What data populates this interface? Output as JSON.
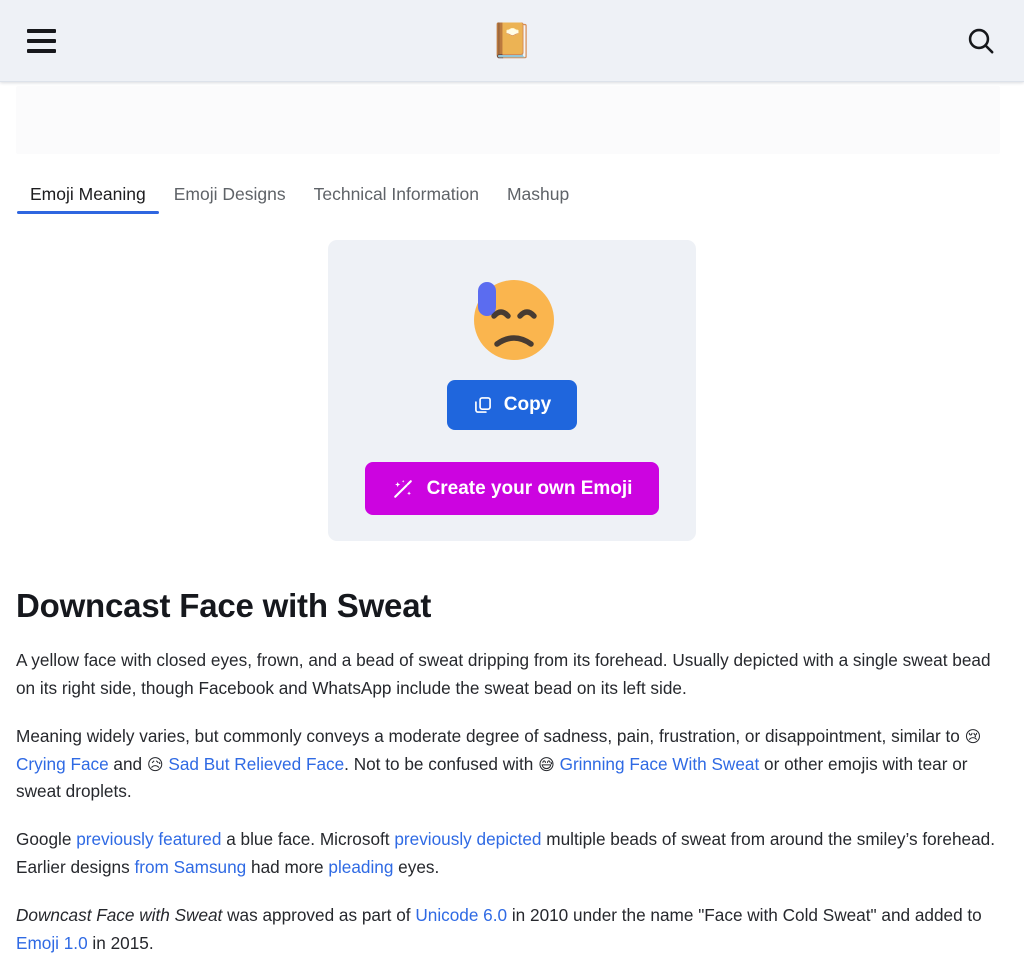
{
  "header": {
    "menu_icon": "hamburger-menu-icon",
    "logo_icon": "notebook-with-decorative-cover-emoji",
    "logo_glyph": "📔",
    "search_icon": "search-icon"
  },
  "ad_slot": {
    "label": ""
  },
  "tabs": [
    {
      "label": "Emoji Meaning",
      "active": true
    },
    {
      "label": "Emoji Designs",
      "active": false
    },
    {
      "label": "Technical Information",
      "active": false
    },
    {
      "label": "Mashup",
      "active": false
    }
  ],
  "emoji_card": {
    "emoji_name": "downcast-face-with-sweat",
    "emoji_glyph": "😓",
    "colors": {
      "face": "#fab54e",
      "features": "#473b32",
      "sweat": "#5b6cf0",
      "card_bg": "#eef1f6"
    },
    "copy_button": {
      "label": "Copy",
      "icon": "copy-icon",
      "color": "#1f66dd"
    },
    "create_button": {
      "label": "Create your own Emoji",
      "icon": "magic-wand-icon",
      "color": "#cc04e0"
    }
  },
  "article": {
    "title": "Downcast Face with Sweat",
    "paragraphs": {
      "p1": {
        "t1": "A yellow face with closed eyes, frown, and a bead of sweat dripping from its forehead. Usually depicted with a single sweat bead on its right side, though Facebook and WhatsApp include the sweat bead on its left side."
      },
      "p2": {
        "t1": "Meaning widely varies, but commonly conveys a moderate degree of sadness, pain, frustration, or disappointment, similar to ",
        "e1": "😢",
        "l1": "Crying Face",
        "t2": " and ",
        "e2": "😥",
        "l2": "Sad But Relieved Face",
        "t3": ". Not to be confused with ",
        "e3": "😅",
        "l3": "Grinning Face With Sweat",
        "t4": " or other emojis with tear or sweat droplets."
      },
      "p3": {
        "t1": "Google ",
        "l1": "previously featured",
        "t2": " a blue face. Microsoft ",
        "l2": "previously depicted",
        "t3": " multiple beads of sweat from around the smiley’s forehead. Earlier designs ",
        "l3": "from Samsung",
        "t4": " had more ",
        "l4": "pleading",
        "t5": " eyes."
      },
      "p4": {
        "i1": "Downcast Face with Sweat",
        "t1": " was approved as part of ",
        "l1": "Unicode 6.0",
        "t2": " in 2010 under the name \"Face with Cold Sweat\" and added to ",
        "l2": "Emoji 1.0",
        "t3": " in 2015."
      }
    }
  }
}
